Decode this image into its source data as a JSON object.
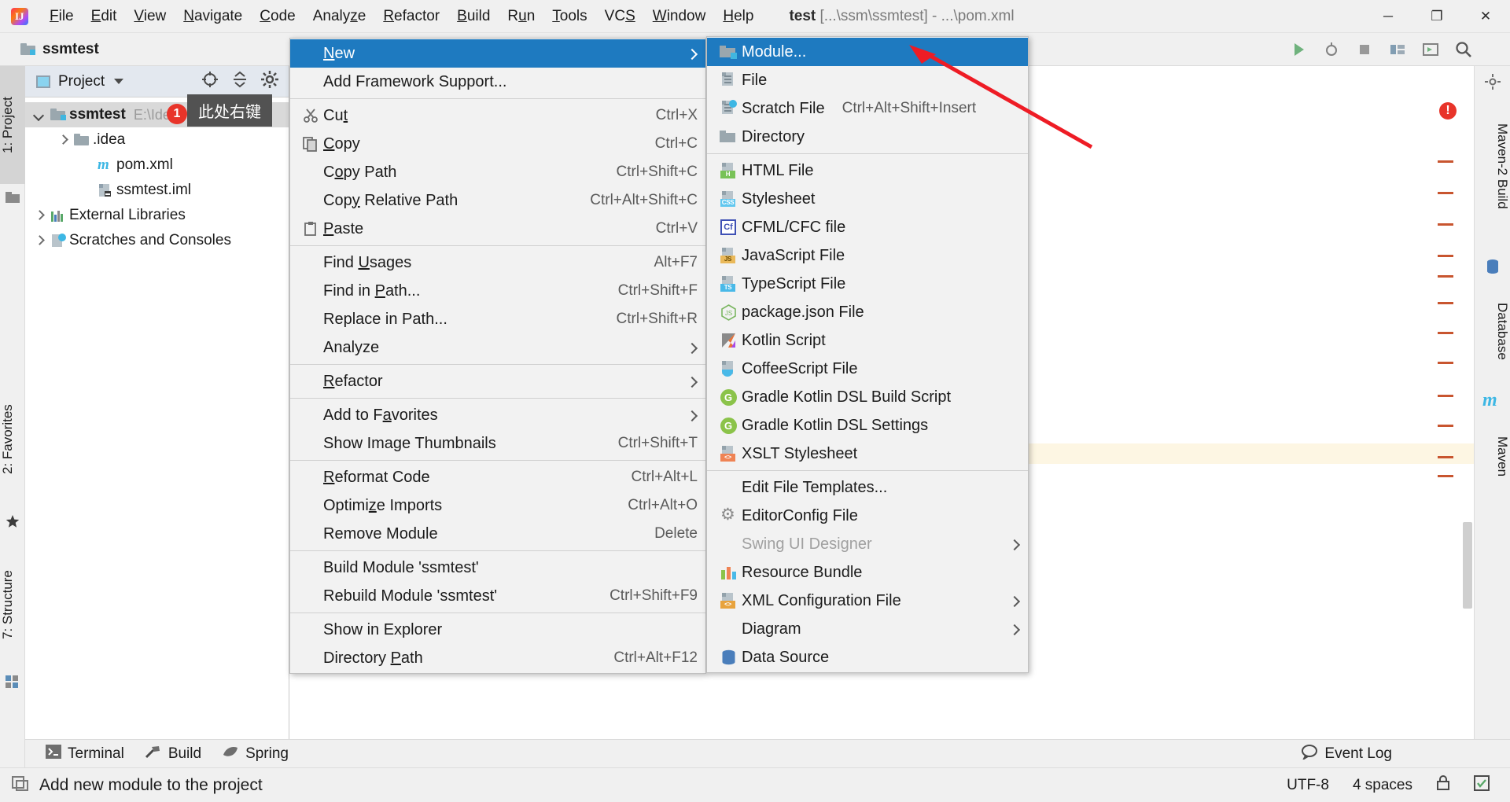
{
  "titlebar": {
    "logo": "intellij-logo",
    "menus": [
      {
        "label": "File",
        "mn": "F"
      },
      {
        "label": "Edit",
        "mn": "E"
      },
      {
        "label": "View",
        "mn": "V"
      },
      {
        "label": "Navigate",
        "mn": "N"
      },
      {
        "label": "Code",
        "mn": "C"
      },
      {
        "label": "Analyze",
        "mn": "z"
      },
      {
        "label": "Refactor",
        "mn": "R"
      },
      {
        "label": "Build",
        "mn": "B"
      },
      {
        "label": "Run",
        "mn": "u"
      },
      {
        "label": "Tools",
        "mn": "T"
      },
      {
        "label": "VCS",
        "mn": "S"
      },
      {
        "label": "Window",
        "mn": "W"
      },
      {
        "label": "Help",
        "mn": "H"
      }
    ],
    "project_name": "test",
    "project_path": "[...\\ssm\\ssmtest]",
    "separator": "-",
    "open_file": "...\\pom.xml",
    "minimize": "─",
    "maximize": "❐",
    "close": "✕"
  },
  "navbar": {
    "breadcrumb": "ssmtest"
  },
  "left_strip": {
    "project_tab": "1: Project",
    "favorites_tab": "2: Favorites",
    "structure_tab": "7: Structure"
  },
  "right_strip": {
    "maven_build_tab": "Maven-2 Build",
    "database_tab": "Database",
    "maven_tab": "Maven"
  },
  "project_panel": {
    "title": "Project",
    "tooltip": "此处右键",
    "badge": "1",
    "tree": [
      {
        "label": "ssmtest",
        "path": "E:\\IdeaProject\\ssm\\s",
        "icon": "module-folder-icon",
        "depth": 0,
        "arrow": "down",
        "bold": true,
        "selected": true
      },
      {
        "label": ".idea",
        "path": "",
        "icon": "folder-icon",
        "depth": 1,
        "arrow": "right",
        "bold": false,
        "selected": false
      },
      {
        "label": "pom.xml",
        "path": "",
        "icon": "maven-pom-icon",
        "depth": 2,
        "arrow": "none",
        "bold": false,
        "selected": false
      },
      {
        "label": "ssmtest.iml",
        "path": "",
        "icon": "iml-file-icon",
        "depth": 2,
        "arrow": "none",
        "bold": false,
        "selected": false
      },
      {
        "label": "External Libraries",
        "path": "",
        "icon": "libraries-icon",
        "depth": 0,
        "arrow": "right",
        "bold": false,
        "selected": false
      },
      {
        "label": "Scratches and Consoles",
        "path": "",
        "icon": "scratches-icon",
        "depth": 0,
        "arrow": "right",
        "bold": false,
        "selected": false
      }
    ]
  },
  "context_menu": {
    "items": [
      {
        "label": "New",
        "mn": "N",
        "shortcut": "",
        "icon": "",
        "submenu": true,
        "highlighted": true,
        "sep_after": false
      },
      {
        "label": "Add Framework Support...",
        "mn": "",
        "shortcut": "",
        "icon": "",
        "submenu": false,
        "highlighted": false,
        "sep_after": true
      },
      {
        "label": "Cut",
        "mn": "t",
        "shortcut": "Ctrl+X",
        "icon": "cut-icon",
        "submenu": false,
        "highlighted": false,
        "sep_after": false
      },
      {
        "label": "Copy",
        "mn": "C",
        "shortcut": "Ctrl+C",
        "icon": "copy-icon",
        "submenu": false,
        "highlighted": false,
        "sep_after": false
      },
      {
        "label": "Copy Path",
        "mn": "o",
        "shortcut": "Ctrl+Shift+C",
        "icon": "",
        "submenu": false,
        "highlighted": false,
        "sep_after": false
      },
      {
        "label": "Copy Relative Path",
        "mn": "y",
        "shortcut": "Ctrl+Alt+Shift+C",
        "icon": "",
        "submenu": false,
        "highlighted": false,
        "sep_after": false
      },
      {
        "label": "Paste",
        "mn": "P",
        "shortcut": "Ctrl+V",
        "icon": "paste-icon",
        "submenu": false,
        "highlighted": false,
        "sep_after": true
      },
      {
        "label": "Find Usages",
        "mn": "U",
        "shortcut": "Alt+F7",
        "icon": "",
        "submenu": false,
        "highlighted": false,
        "sep_after": false
      },
      {
        "label": "Find in Path...",
        "mn": "P",
        "shortcut": "Ctrl+Shift+F",
        "icon": "",
        "submenu": false,
        "highlighted": false,
        "sep_after": false
      },
      {
        "label": "Replace in Path...",
        "mn": "",
        "shortcut": "Ctrl+Shift+R",
        "icon": "",
        "submenu": false,
        "highlighted": false,
        "sep_after": false
      },
      {
        "label": "Analyze",
        "mn": "",
        "shortcut": "",
        "icon": "",
        "submenu": true,
        "highlighted": false,
        "sep_after": true
      },
      {
        "label": "Refactor",
        "mn": "R",
        "shortcut": "",
        "icon": "",
        "submenu": true,
        "highlighted": false,
        "sep_after": true
      },
      {
        "label": "Add to Favorites",
        "mn": "a",
        "shortcut": "",
        "icon": "",
        "submenu": true,
        "highlighted": false,
        "sep_after": false
      },
      {
        "label": "Show Image Thumbnails",
        "mn": "",
        "shortcut": "Ctrl+Shift+T",
        "icon": "",
        "submenu": false,
        "highlighted": false,
        "sep_after": true
      },
      {
        "label": "Reformat Code",
        "mn": "R",
        "shortcut": "Ctrl+Alt+L",
        "icon": "",
        "submenu": false,
        "highlighted": false,
        "sep_after": false
      },
      {
        "label": "Optimize Imports",
        "mn": "z",
        "shortcut": "Ctrl+Alt+O",
        "icon": "",
        "submenu": false,
        "highlighted": false,
        "sep_after": false
      },
      {
        "label": "Remove Module",
        "mn": "",
        "shortcut": "Delete",
        "icon": "",
        "submenu": false,
        "highlighted": false,
        "sep_after": true
      },
      {
        "label": "Build Module 'ssmtest'",
        "mn": "",
        "shortcut": "",
        "icon": "",
        "submenu": false,
        "highlighted": false,
        "sep_after": false
      },
      {
        "label": "Rebuild Module 'ssmtest'",
        "mn": "",
        "shortcut": "Ctrl+Shift+F9",
        "icon": "",
        "submenu": false,
        "highlighted": false,
        "sep_after": true
      },
      {
        "label": "Show in Explorer",
        "mn": "",
        "shortcut": "",
        "icon": "",
        "submenu": false,
        "highlighted": false,
        "sep_after": false
      },
      {
        "label": "Directory Path",
        "mn": "P",
        "shortcut": "Ctrl+Alt+F12",
        "icon": "",
        "submenu": false,
        "highlighted": false,
        "sep_after": false
      }
    ]
  },
  "submenu": {
    "items": [
      {
        "label": "Module...",
        "icon": "module-icon",
        "shortcut": "",
        "submenu": false,
        "highlighted": true,
        "disabled": false,
        "sep_after": false
      },
      {
        "label": "File",
        "icon": "file-icon",
        "shortcut": "",
        "submenu": false,
        "highlighted": false,
        "disabled": false,
        "sep_after": false
      },
      {
        "label": "Scratch File",
        "icon": "scratch-file-icon",
        "shortcut": "Ctrl+Alt+Shift+Insert",
        "submenu": false,
        "highlighted": false,
        "disabled": false,
        "sep_after": false
      },
      {
        "label": "Directory",
        "icon": "directory-icon",
        "shortcut": "",
        "submenu": false,
        "highlighted": false,
        "disabled": false,
        "sep_after": true
      },
      {
        "label": "HTML File",
        "icon": "html-file-icon",
        "shortcut": "",
        "submenu": false,
        "highlighted": false,
        "disabled": false,
        "sep_after": false
      },
      {
        "label": "Stylesheet",
        "icon": "css-file-icon",
        "shortcut": "",
        "submenu": false,
        "highlighted": false,
        "disabled": false,
        "sep_after": false
      },
      {
        "label": "CFML/CFC file",
        "icon": "cfml-file-icon",
        "shortcut": "",
        "submenu": false,
        "highlighted": false,
        "disabled": false,
        "sep_after": false
      },
      {
        "label": "JavaScript File",
        "icon": "js-file-icon",
        "shortcut": "",
        "submenu": false,
        "highlighted": false,
        "disabled": false,
        "sep_after": false
      },
      {
        "label": "TypeScript File",
        "icon": "ts-file-icon",
        "shortcut": "",
        "submenu": false,
        "highlighted": false,
        "disabled": false,
        "sep_after": false
      },
      {
        "label": "package.json File",
        "icon": "nodejs-icon",
        "shortcut": "",
        "submenu": false,
        "highlighted": false,
        "disabled": false,
        "sep_after": false
      },
      {
        "label": "Kotlin Script",
        "icon": "kotlin-icon",
        "shortcut": "",
        "submenu": false,
        "highlighted": false,
        "disabled": false,
        "sep_after": false
      },
      {
        "label": "CoffeeScript File",
        "icon": "coffeescript-icon",
        "shortcut": "",
        "submenu": false,
        "highlighted": false,
        "disabled": false,
        "sep_after": false
      },
      {
        "label": "Gradle Kotlin DSL Build Script",
        "icon": "gradle-icon",
        "shortcut": "",
        "submenu": false,
        "highlighted": false,
        "disabled": false,
        "sep_after": false
      },
      {
        "label": "Gradle Kotlin DSL Settings",
        "icon": "gradle-icon",
        "shortcut": "",
        "submenu": false,
        "highlighted": false,
        "disabled": false,
        "sep_after": false
      },
      {
        "label": "XSLT Stylesheet",
        "icon": "xslt-file-icon",
        "shortcut": "",
        "submenu": false,
        "highlighted": false,
        "disabled": false,
        "sep_after": true
      },
      {
        "label": "Edit File Templates...",
        "icon": "",
        "shortcut": "",
        "submenu": false,
        "highlighted": false,
        "disabled": false,
        "sep_after": false
      },
      {
        "label": "EditorConfig File",
        "icon": "gear-icon",
        "shortcut": "",
        "submenu": false,
        "highlighted": false,
        "disabled": false,
        "sep_after": false
      },
      {
        "label": "Swing UI Designer",
        "icon": "",
        "shortcut": "",
        "submenu": true,
        "highlighted": false,
        "disabled": true,
        "sep_after": false
      },
      {
        "label": "Resource Bundle",
        "icon": "resource-bundle-icon",
        "shortcut": "",
        "submenu": false,
        "highlighted": false,
        "disabled": false,
        "sep_after": false
      },
      {
        "label": "XML Configuration File",
        "icon": "xml-file-icon",
        "shortcut": "",
        "submenu": true,
        "highlighted": false,
        "disabled": false,
        "sep_after": false
      },
      {
        "label": "Diagram",
        "icon": "",
        "shortcut": "",
        "submenu": true,
        "highlighted": false,
        "disabled": false,
        "sep_after": false
      },
      {
        "label": "Data Source",
        "icon": "datasource-icon",
        "shortcut": "",
        "submenu": false,
        "highlighted": false,
        "disabled": false,
        "sep_after": false
      }
    ]
  },
  "bottom_tabs": {
    "terminal": "Terminal",
    "build": "Build",
    "spring": "Spring",
    "event_log": "Event Log"
  },
  "statusbar": {
    "message": "Add new module to the project",
    "encoding": "UTF-8",
    "indent": "4 spaces"
  },
  "colors": {
    "accent": "#1e7ac0",
    "error": "#e8342a",
    "annotation_arrow": "#ee1c25",
    "tooltip_bg": "#525252"
  }
}
